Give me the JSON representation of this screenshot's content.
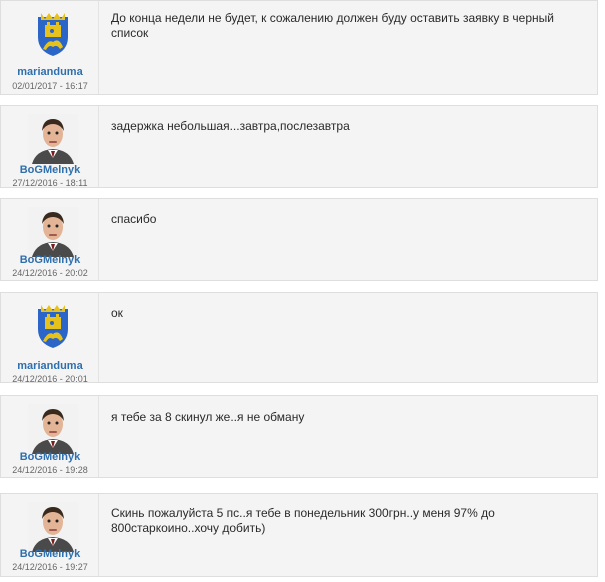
{
  "messages": [
    {
      "username": "marianduma",
      "date": "02/01/2017 - 16:17",
      "avatar": "lviv-coat-of-arms",
      "text": "До конца недели не будет, к сожалению должен буду оставить заявку в черный\nсписок"
    },
    {
      "username": "BoGMelnyk",
      "date": "27/12/2016 - 18:11",
      "avatar": "mr-bean-photo",
      "text": "задержка небольшая...завтра,послезавтра"
    },
    {
      "username": "BoGMelnyk",
      "date": "24/12/2016 - 20:02",
      "avatar": "mr-bean-photo",
      "text": "спасибо"
    },
    {
      "username": "marianduma",
      "date": "24/12/2016 - 20:01",
      "avatar": "lviv-coat-of-arms",
      "text": "ок"
    },
    {
      "username": "BoGMelnyk",
      "date": "24/12/2016 - 19:28",
      "avatar": "mr-bean-photo",
      "text": "я тебе за 8 скинул же..я не обману"
    },
    {
      "username": "BoGMelnyk",
      "date": "24/12/2016 - 19:27",
      "avatar": "mr-bean-photo",
      "text": "Скинь пожалуйста 5 пс..я тебе в понедельник 300грн..у меня 97% до\n800старкоино..хочу добить)"
    }
  ]
}
